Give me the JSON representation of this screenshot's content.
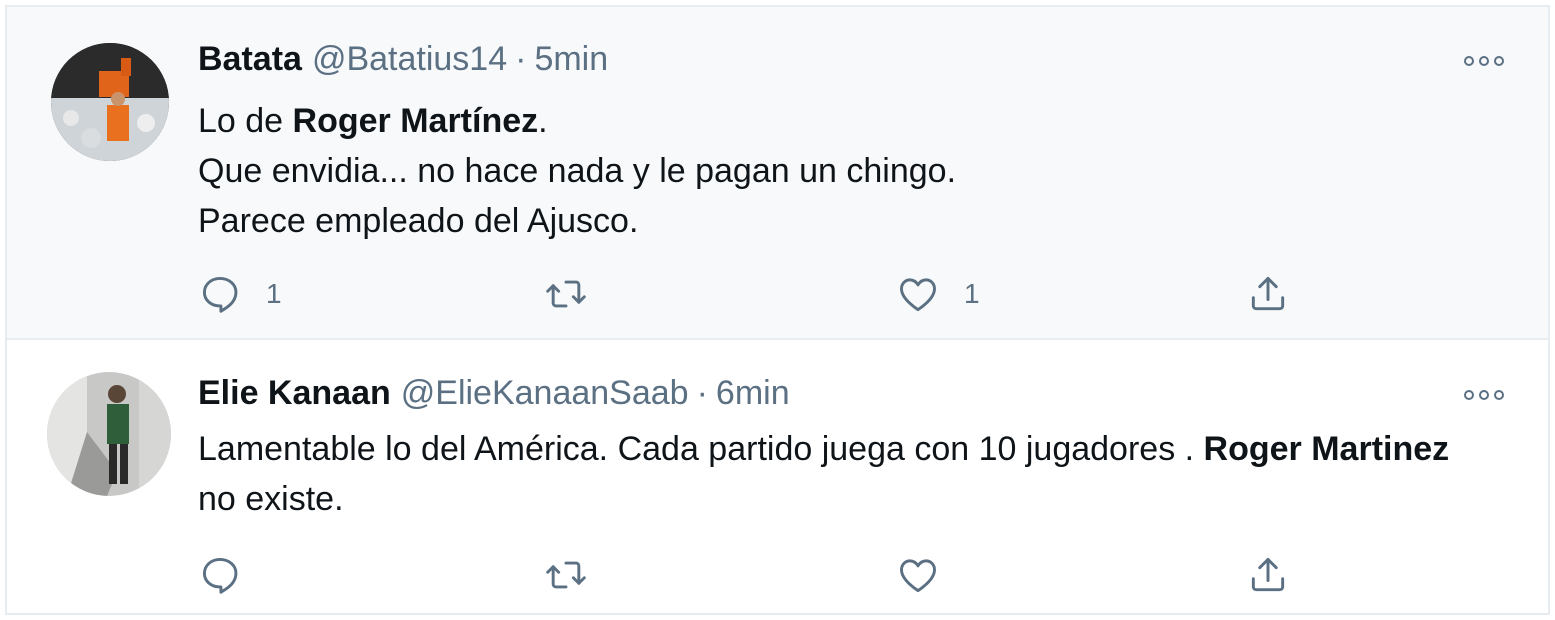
{
  "tweets": [
    {
      "display_name": "Batata",
      "handle": "@Batatius14",
      "separator": "·",
      "time": "5min",
      "lines": [
        {
          "pre": "Lo de ",
          "bold": "Roger Martínez",
          "post": "."
        },
        {
          "text": "Que envidia... no hace nada y le pagan un chingo."
        },
        {
          "text": "Parece empleado del Ajusco."
        }
      ],
      "reply_count": "1",
      "retweet_count": "",
      "like_count": "1"
    },
    {
      "display_name": "Elie Kanaan",
      "handle": "@ElieKanaanSaab",
      "separator": "·",
      "time": "6min",
      "body": {
        "pre": "Lamentable lo del América. Cada partido juega con 10 jugadores . ",
        "bold": "Roger Martinez",
        "post": " no existe."
      },
      "reply_count": "",
      "retweet_count": "",
      "like_count": ""
    }
  ],
  "icons": {
    "reply": "reply-icon",
    "retweet": "retweet-icon",
    "like": "heart-icon",
    "share": "share-icon",
    "more": "more-icon"
  },
  "colors": {
    "secondary_text": "#5b7083",
    "highlight_bg": "#f7f9fa",
    "border": "#e6ecf0"
  }
}
